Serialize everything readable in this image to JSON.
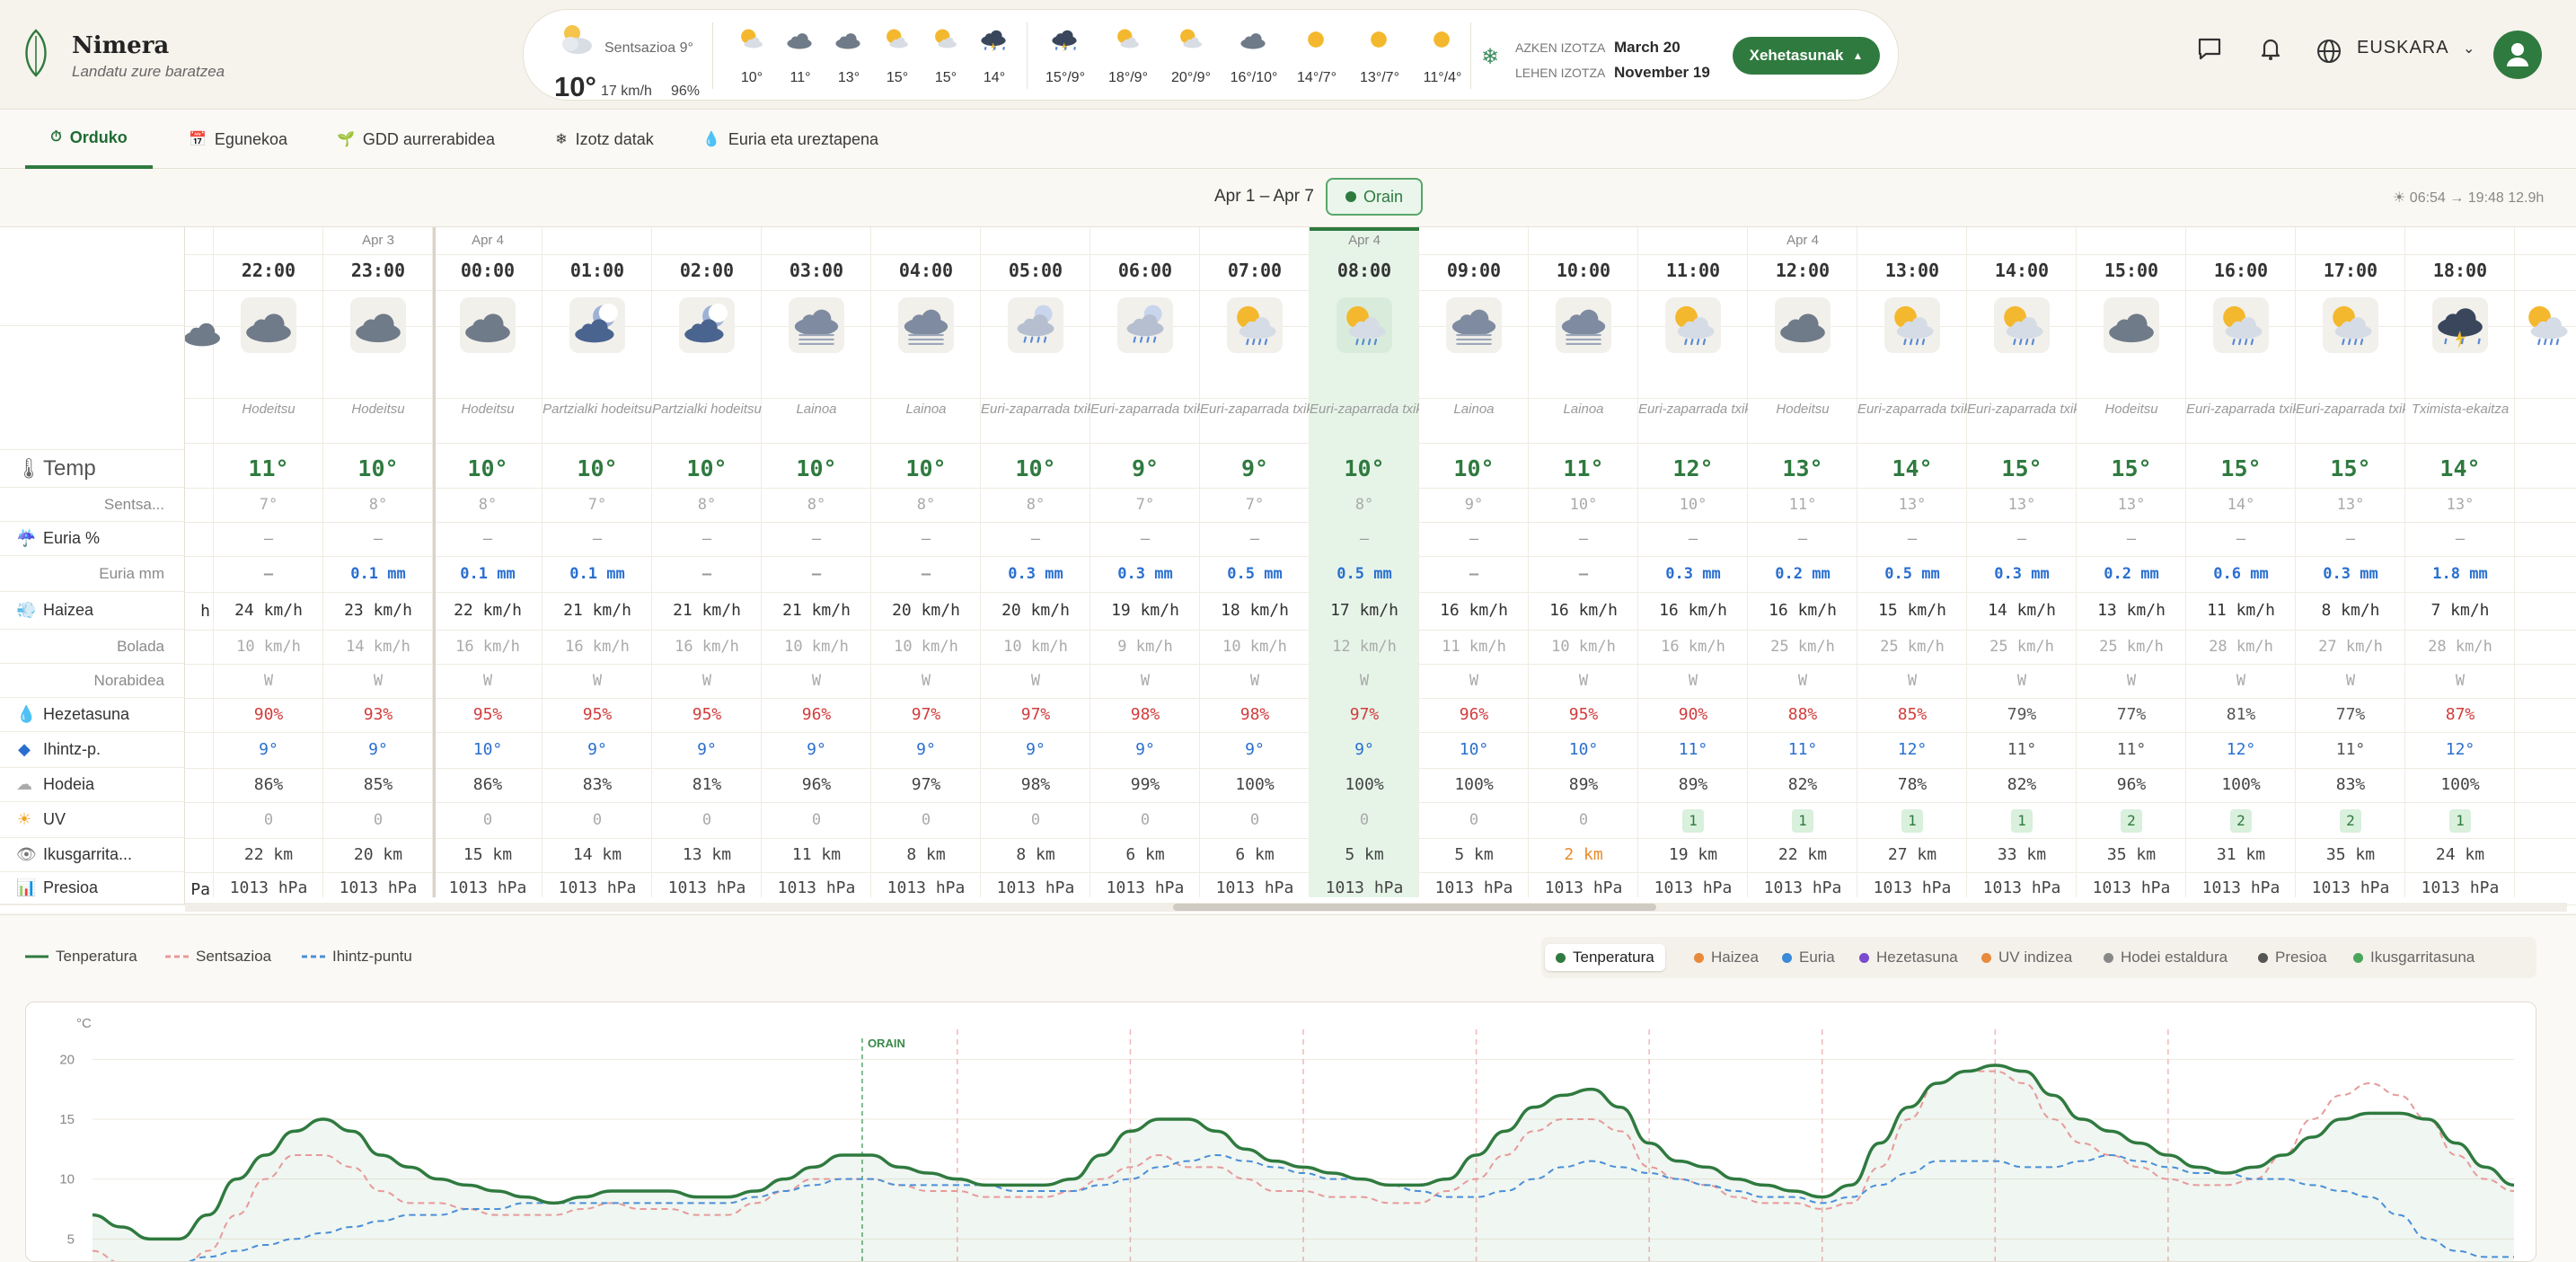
{
  "brand": {
    "name": "Nimera",
    "tagline": "Landatu zure baratzea"
  },
  "current": {
    "feels": "Sentsazioa 9°",
    "temp": "10°",
    "wind": "17 km/h",
    "humidity": "96%"
  },
  "mini_now": [
    "10°",
    "11°",
    "13°",
    "15°",
    "15°",
    "14°"
  ],
  "mini_days": [
    "15°/9°",
    "18°/9°",
    "20°/9°",
    "16°/10°",
    "14°/7°",
    "13°/7°",
    "11°/4°"
  ],
  "frost": {
    "last_label": "AZKEN IZOTZA",
    "last_value": "March 20",
    "first_label": "LEHEN IZOTZA",
    "first_value": "November 19"
  },
  "details_button": "Xehetasunak",
  "language": "EUSKARA",
  "tabs": [
    {
      "label": "Orduko",
      "icon": "clock-icon",
      "active": true
    },
    {
      "label": "Egunekoa",
      "icon": "calendar-icon"
    },
    {
      "label": "GDD aurrerabidea",
      "icon": "sprout-icon"
    },
    {
      "label": "Izotz datak",
      "icon": "snowflake-icon"
    },
    {
      "label": "Euria eta ureztapena",
      "icon": "droplet-icon"
    }
  ],
  "date_range": "Apr 1 – Apr 7",
  "now_button": "Orain",
  "sun_info": "☀ 06:54 → 19:48  12.9h",
  "row_labels": {
    "temp": "Temp",
    "feels": "Sentsa...",
    "rain_pct": "Euria %",
    "rain_mm": "Euria mm",
    "wind": "Haizea",
    "gust": "Bolada",
    "dir": "Norabidea",
    "humidity": "Hezetasuna",
    "dew": "Ihintz-p.",
    "cloud": "Hodeia",
    "uv": "UV",
    "vis": "Ikusgarrita...",
    "pressure": "Presioa"
  },
  "left_partial": {
    "wind": "h",
    "pressure": "Pa"
  },
  "hours": [
    {
      "day": "",
      "time": "22:00",
      "icon": "cloud",
      "cond": "Hodeitsu",
      "temp": "11°",
      "feels": "7°",
      "rain_pct": "–",
      "rain_mm": "–",
      "wind": "24 km/h",
      "gust": "10 km/h",
      "dir": "W",
      "hum": "90%",
      "dew": "9°",
      "cloud": "86%",
      "uv": "0",
      "vis": "22 km",
      "press": "1013 hPa"
    },
    {
      "day": "Apr 3",
      "time": "23:00",
      "icon": "cloud",
      "cond": "Hodeitsu",
      "temp": "10°",
      "feels": "8°",
      "rain_pct": "–",
      "rain_mm": "0.1 mm",
      "wind": "23 km/h",
      "gust": "14 km/h",
      "dir": "W",
      "hum": "93%",
      "dew": "9°",
      "cloud": "85%",
      "uv": "0",
      "vis": "20 km",
      "press": "1013 hPa"
    },
    {
      "day": "Apr 4",
      "time": "00:00",
      "icon": "cloud",
      "cond": "Hodeitsu",
      "temp": "10°",
      "feels": "8°",
      "rain_pct": "–",
      "rain_mm": "0.1 mm",
      "wind": "22 km/h",
      "gust": "16 km/h",
      "dir": "W",
      "hum": "95%",
      "dew": "10°",
      "cloud": "86%",
      "uv": "0",
      "vis": "15 km",
      "press": "1013 hPa"
    },
    {
      "day": "",
      "time": "01:00",
      "icon": "night",
      "cond": "Partzialki hodeitsu",
      "temp": "10°",
      "feels": "7°",
      "rain_pct": "–",
      "rain_mm": "0.1 mm",
      "wind": "21 km/h",
      "gust": "16 km/h",
      "dir": "W",
      "hum": "95%",
      "dew": "9°",
      "cloud": "83%",
      "uv": "0",
      "vis": "14 km",
      "press": "1013 hPa"
    },
    {
      "day": "",
      "time": "02:00",
      "icon": "night",
      "cond": "Partzialki hodeitsu",
      "temp": "10°",
      "feels": "8°",
      "rain_pct": "–",
      "rain_mm": "–",
      "wind": "21 km/h",
      "gust": "16 km/h",
      "dir": "W",
      "hum": "95%",
      "dew": "9°",
      "cloud": "81%",
      "uv": "0",
      "vis": "13 km",
      "press": "1013 hPa"
    },
    {
      "day": "",
      "time": "03:00",
      "icon": "fog",
      "cond": "Lainoa",
      "temp": "10°",
      "feels": "8°",
      "rain_pct": "–",
      "rain_mm": "–",
      "wind": "21 km/h",
      "gust": "10 km/h",
      "dir": "W",
      "hum": "96%",
      "dew": "9°",
      "cloud": "96%",
      "uv": "0",
      "vis": "11 km",
      "press": "1013 hPa"
    },
    {
      "day": "",
      "time": "04:00",
      "icon": "fog",
      "cond": "Lainoa",
      "temp": "10°",
      "feels": "8°",
      "rain_pct": "–",
      "rain_mm": "–",
      "wind": "20 km/h",
      "gust": "10 km/h",
      "dir": "W",
      "hum": "97%",
      "dew": "9°",
      "cloud": "97%",
      "uv": "0",
      "vis": "8 km",
      "press": "1013 hPa"
    },
    {
      "day": "",
      "time": "05:00",
      "icon": "nightrain",
      "cond": "Euri-zaparrada txikia",
      "temp": "10°",
      "feels": "8°",
      "rain_pct": "–",
      "rain_mm": "0.3 mm",
      "wind": "20 km/h",
      "gust": "10 km/h",
      "dir": "W",
      "hum": "97%",
      "dew": "9°",
      "cloud": "98%",
      "uv": "0",
      "vis": "8 km",
      "press": "1013 hPa"
    },
    {
      "day": "",
      "time": "06:00",
      "icon": "nightrain",
      "cond": "Euri-zaparrada txikia",
      "temp": "9°",
      "feels": "7°",
      "rain_pct": "–",
      "rain_mm": "0.3 mm",
      "wind": "19 km/h",
      "gust": "9 km/h",
      "dir": "W",
      "hum": "98%",
      "dew": "9°",
      "cloud": "99%",
      "uv": "0",
      "vis": "6 km",
      "press": "1013 hPa"
    },
    {
      "day": "",
      "time": "07:00",
      "icon": "sunrain",
      "cond": "Euri-zaparrada txikia",
      "temp": "9°",
      "feels": "7°",
      "rain_pct": "–",
      "rain_mm": "0.5 mm",
      "wind": "18 km/h",
      "gust": "10 km/h",
      "dir": "W",
      "hum": "98%",
      "dew": "9°",
      "cloud": "100%",
      "uv": "0",
      "vis": "6 km",
      "press": "1013 hPa"
    },
    {
      "day": "Apr 4",
      "time": "08:00",
      "icon": "sunrain",
      "cond": "Euri-zaparrada txikia",
      "temp": "10°",
      "feels": "8°",
      "rain_pct": "–",
      "rain_mm": "0.5 mm",
      "wind": "17 km/h",
      "gust": "12 km/h",
      "dir": "W",
      "hum": "97%",
      "dew": "9°",
      "cloud": "100%",
      "uv": "0",
      "vis": "5 km",
      "press": "1013 hPa",
      "now": true
    },
    {
      "day": "",
      "time": "09:00",
      "icon": "fog",
      "cond": "Lainoa",
      "temp": "10°",
      "feels": "9°",
      "rain_pct": "–",
      "rain_mm": "–",
      "wind": "16 km/h",
      "gust": "11 km/h",
      "dir": "W",
      "hum": "96%",
      "dew": "10°",
      "cloud": "100%",
      "uv": "0",
      "vis": "5 km",
      "press": "1013 hPa"
    },
    {
      "day": "",
      "time": "10:00",
      "icon": "fog",
      "cond": "Lainoa",
      "temp": "11°",
      "feels": "10°",
      "rain_pct": "–",
      "rain_mm": "–",
      "wind": "16 km/h",
      "gust": "10 km/h",
      "dir": "W",
      "hum": "95%",
      "dew": "10°",
      "cloud": "89%",
      "uv": "0",
      "vis": "2 km",
      "press": "1013 hPa",
      "vis_warn": true
    },
    {
      "day": "",
      "time": "11:00",
      "icon": "sunrain",
      "cond": "Euri-zaparrada txikia",
      "temp": "12°",
      "feels": "10°",
      "rain_pct": "–",
      "rain_mm": "0.3 mm",
      "wind": "16 km/h",
      "gust": "16 km/h",
      "dir": "W",
      "hum": "90%",
      "dew": "11°",
      "cloud": "89%",
      "uv": "1",
      "vis": "19 km",
      "press": "1013 hPa"
    },
    {
      "day": "Apr 4",
      "time": "12:00",
      "icon": "cloud",
      "cond": "Hodeitsu",
      "temp": "13°",
      "feels": "11°",
      "rain_pct": "–",
      "rain_mm": "0.2 mm",
      "wind": "16 km/h",
      "gust": "25 km/h",
      "dir": "W",
      "hum": "88%",
      "dew": "11°",
      "cloud": "82%",
      "uv": "1",
      "vis": "22 km",
      "press": "1013 hPa"
    },
    {
      "day": "",
      "time": "13:00",
      "icon": "sunrain",
      "cond": "Euri-zaparrada txikia",
      "temp": "14°",
      "feels": "13°",
      "rain_pct": "–",
      "rain_mm": "0.5 mm",
      "wind": "15 km/h",
      "gust": "25 km/h",
      "dir": "W",
      "hum": "85%",
      "dew": "12°",
      "cloud": "78%",
      "uv": "1",
      "vis": "27 km",
      "press": "1013 hPa"
    },
    {
      "day": "",
      "time": "14:00",
      "icon": "sunrain",
      "cond": "Euri-zaparrada txikia",
      "temp": "15°",
      "feels": "13°",
      "rain_pct": "–",
      "rain_mm": "0.3 mm",
      "wind": "14 km/h",
      "gust": "25 km/h",
      "dir": "W",
      "hum": "79%",
      "dew": "11°",
      "cloud": "82%",
      "uv": "1",
      "vis": "33 km",
      "press": "1013 hPa"
    },
    {
      "day": "",
      "time": "15:00",
      "icon": "cloud",
      "cond": "Hodeitsu",
      "temp": "15°",
      "feels": "13°",
      "rain_pct": "–",
      "rain_mm": "0.2 mm",
      "wind": "13 km/h",
      "gust": "25 km/h",
      "dir": "W",
      "hum": "77%",
      "dew": "11°",
      "cloud": "96%",
      "uv": "2",
      "vis": "35 km",
      "press": "1013 hPa"
    },
    {
      "day": "",
      "time": "16:00",
      "icon": "sunrain",
      "cond": "Euri-zaparrada txikia",
      "temp": "15°",
      "feels": "14°",
      "rain_pct": "–",
      "rain_mm": "0.6 mm",
      "wind": "11 km/h",
      "gust": "28 km/h",
      "dir": "W",
      "hum": "81%",
      "dew": "12°",
      "cloud": "100%",
      "uv": "2",
      "vis": "31 km",
      "press": "1013 hPa"
    },
    {
      "day": "",
      "time": "17:00",
      "icon": "sunrain",
      "cond": "Euri-zaparrada txikia",
      "temp": "15°",
      "feels": "13°",
      "rain_pct": "–",
      "rain_mm": "0.3 mm",
      "wind": "8 km/h",
      "gust": "27 km/h",
      "dir": "W",
      "hum": "77%",
      "dew": "11°",
      "cloud": "83%",
      "uv": "2",
      "vis": "35 km",
      "press": "1013 hPa"
    },
    {
      "day": "",
      "time": "18:00",
      "icon": "storm",
      "cond": "Tximista-ekaitza",
      "temp": "14°",
      "feels": "13°",
      "rain_pct": "–",
      "rain_mm": "1.8 mm",
      "wind": "7 km/h",
      "gust": "28 km/h",
      "dir": "W",
      "hum": "87%",
      "dew": "12°",
      "cloud": "100%",
      "uv": "1",
      "vis": "24 km",
      "press": "1013 hPa"
    }
  ],
  "chart_legend": [
    {
      "label": "Tenperatura",
      "color": "#2f7a3f",
      "style": "solid"
    },
    {
      "label": "Sentsazioa",
      "color": "#e79a9a",
      "style": "dashed"
    },
    {
      "label": "Ihintz-puntu",
      "color": "#4a8fd8",
      "style": "dashed"
    }
  ],
  "metric_tabs": [
    {
      "label": "Tenperatura",
      "color": "#2f7a3f",
      "active": true
    },
    {
      "label": "Haizea",
      "color": "#e88a3a"
    },
    {
      "label": "Euria",
      "color": "#3a8ad8"
    },
    {
      "label": "Hezetasuna",
      "color": "#7a4ad0"
    },
    {
      "label": "UV indizea",
      "color": "#e88a3a"
    },
    {
      "label": "Hodei estaldura",
      "color": "#888888"
    },
    {
      "label": "Presioa",
      "color": "#555555"
    },
    {
      "label": "Ikusgarritasuna",
      "color": "#4aa65a"
    }
  ],
  "chart_data": {
    "type": "line",
    "ylabel": "°C",
    "yticks": [
      5,
      10,
      15,
      20
    ],
    "ylim": [
      3,
      24
    ],
    "now_label": "ORAIN",
    "series": [
      {
        "name": "Tenperatura",
        "color": "#2f7a3f",
        "values": [
          7,
          6,
          5,
          5,
          7,
          10,
          12,
          14,
          15,
          14,
          12,
          11,
          10,
          9.5,
          9,
          8.5,
          8,
          8.5,
          9,
          9,
          9,
          8.5,
          8.5,
          9,
          10,
          11,
          12,
          12,
          11,
          10.5,
          10,
          9.5,
          9.5,
          9.5,
          10,
          12,
          14,
          15,
          15,
          14,
          12.5,
          11.5,
          11,
          10.5,
          10,
          9.5,
          9.5,
          10,
          12,
          14,
          16,
          17,
          17.5,
          16,
          13,
          11.5,
          11,
          10,
          9.5,
          9,
          8.5,
          9.5,
          13,
          16,
          18,
          19,
          19.5,
          19,
          17,
          15,
          14,
          13,
          12,
          11,
          10.5,
          11,
          12,
          13.5,
          15,
          15.5,
          15.5,
          15,
          13,
          11,
          9.5
        ]
      },
      {
        "name": "Sentsazioa",
        "color": "#e79a9a",
        "values": [
          4,
          3,
          2,
          2,
          4,
          7,
          10,
          12,
          12,
          11,
          9,
          8,
          8,
          7.5,
          7,
          7,
          7,
          7.5,
          8,
          7.5,
          7.5,
          7,
          7,
          8,
          9,
          10,
          10,
          10,
          9.5,
          9,
          9,
          8.5,
          8.5,
          8.5,
          9,
          10,
          11,
          12,
          11,
          11,
          10,
          9,
          9,
          8.5,
          8.5,
          8,
          8,
          9,
          10,
          12,
          14,
          15,
          15,
          14,
          11,
          10,
          9.5,
          8.5,
          8,
          8,
          7.5,
          8,
          11,
          15,
          18,
          19,
          19,
          18,
          15,
          13,
          12,
          11,
          10,
          9.5,
          9.5,
          10,
          12,
          15,
          17,
          18,
          17,
          15,
          12,
          10,
          9
        ]
      },
      {
        "name": "Ihintz-puntu",
        "color": "#4a8fd8",
        "values": [
          3,
          3,
          3,
          3,
          3.5,
          4,
          4.5,
          5,
          5.5,
          6,
          6.5,
          7,
          7,
          7.5,
          7.5,
          8,
          8,
          8,
          8,
          8,
          8,
          8,
          8,
          8.5,
          9,
          9.5,
          10,
          10,
          9.5,
          9.5,
          9.5,
          9.5,
          9,
          9,
          9,
          9.5,
          10,
          11,
          11.5,
          12,
          11.5,
          11,
          10.5,
          10,
          10,
          9.5,
          9,
          8.5,
          8.5,
          9,
          10,
          11,
          11.5,
          11,
          10.5,
          10,
          9.5,
          9,
          8.5,
          8.5,
          8,
          8.5,
          9.5,
          10.5,
          11.5,
          11.5,
          11.5,
          11,
          11,
          11.5,
          12,
          11.5,
          11,
          10.5,
          10.5,
          10,
          10,
          9.5,
          9,
          8.5,
          7,
          5,
          4,
          3.5,
          3.5
        ]
      }
    ]
  }
}
